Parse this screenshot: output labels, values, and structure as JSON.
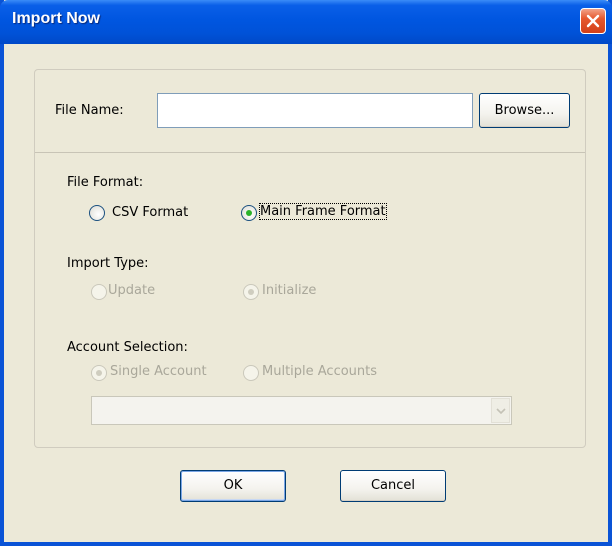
{
  "window": {
    "title": "Import Now"
  },
  "file": {
    "label": "File Name:",
    "value": "",
    "browse_label": "Browse..."
  },
  "file_format": {
    "label": "File Format:",
    "options": [
      {
        "label": "CSV Format",
        "selected": false
      },
      {
        "label": "Main Frame Format",
        "selected": true
      }
    ]
  },
  "import_type": {
    "label": "Import Type:",
    "options": [
      {
        "label": "Update",
        "selected": false,
        "enabled": false
      },
      {
        "label": "Initialize",
        "selected": true,
        "enabled": false
      }
    ]
  },
  "account_selection": {
    "label": "Account Selection:",
    "options": [
      {
        "label": "Single Account",
        "selected": true,
        "enabled": false
      },
      {
        "label": "Multiple Accounts",
        "selected": false,
        "enabled": false
      }
    ],
    "account_value": ""
  },
  "buttons": {
    "ok": "OK",
    "cancel": "Cancel"
  },
  "colors": {
    "titlebar": "#0054e3",
    "dialog_bg": "#ece9d8",
    "radio_dot": "#2ab22a"
  },
  "icons": {
    "close": "close-icon",
    "combo_arrow": "chevron-down-icon"
  }
}
